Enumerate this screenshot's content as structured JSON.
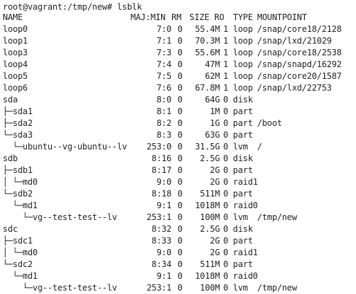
{
  "prompt": "root@vagrant:/tmp/new# lsblk",
  "headers": {
    "name": "NAME",
    "majmin": "MAJ:MIN",
    "rm": "RM",
    "size": "SIZE",
    "ro": "RO",
    "type": "TYPE",
    "mountpoint": "MOUNTPOINT"
  },
  "rows": [
    {
      "name": "loop0",
      "majmin": "7:0",
      "rm": "0",
      "size": "55.4M",
      "ro": "1",
      "type": "loop",
      "mountpoint": "/snap/core18/2128"
    },
    {
      "name": "loop1",
      "majmin": "7:1",
      "rm": "0",
      "size": "70.3M",
      "ro": "1",
      "type": "loop",
      "mountpoint": "/snap/lxd/21029"
    },
    {
      "name": "loop3",
      "majmin": "7:3",
      "rm": "0",
      "size": "55.6M",
      "ro": "1",
      "type": "loop",
      "mountpoint": "/snap/core18/2538"
    },
    {
      "name": "loop4",
      "majmin": "7:4",
      "rm": "0",
      "size": "47M",
      "ro": "1",
      "type": "loop",
      "mountpoint": "/snap/snapd/16292"
    },
    {
      "name": "loop5",
      "majmin": "7:5",
      "rm": "0",
      "size": "62M",
      "ro": "1",
      "type": "loop",
      "mountpoint": "/snap/core20/1587"
    },
    {
      "name": "loop6",
      "majmin": "7:6",
      "rm": "0",
      "size": "67.8M",
      "ro": "1",
      "type": "loop",
      "mountpoint": "/snap/lxd/22753"
    },
    {
      "name": "sda",
      "majmin": "8:0",
      "rm": "0",
      "size": "64G",
      "ro": "0",
      "type": "disk",
      "mountpoint": ""
    },
    {
      "name": "├─sda1",
      "majmin": "8:1",
      "rm": "0",
      "size": "1M",
      "ro": "0",
      "type": "part",
      "mountpoint": ""
    },
    {
      "name": "├─sda2",
      "majmin": "8:2",
      "rm": "0",
      "size": "1G",
      "ro": "0",
      "type": "part",
      "mountpoint": "/boot"
    },
    {
      "name": "└─sda3",
      "majmin": "8:3",
      "rm": "0",
      "size": "63G",
      "ro": "0",
      "type": "part",
      "mountpoint": ""
    },
    {
      "name": "  └─ubuntu--vg-ubuntu--lv",
      "majmin": "253:0",
      "rm": "0",
      "size": "31.5G",
      "ro": "0",
      "type": "lvm",
      "mountpoint": "/"
    },
    {
      "name": "sdb",
      "majmin": "8:16",
      "rm": "0",
      "size": "2.5G",
      "ro": "0",
      "type": "disk",
      "mountpoint": ""
    },
    {
      "name": "├─sdb1",
      "majmin": "8:17",
      "rm": "0",
      "size": "2G",
      "ro": "0",
      "type": "part",
      "mountpoint": ""
    },
    {
      "name": "│ └─md0",
      "majmin": "9:0",
      "rm": "0",
      "size": "2G",
      "ro": "0",
      "type": "raid1",
      "mountpoint": ""
    },
    {
      "name": "└─sdb2",
      "majmin": "8:18",
      "rm": "0",
      "size": "511M",
      "ro": "0",
      "type": "part",
      "mountpoint": ""
    },
    {
      "name": "  └─md1",
      "majmin": "9:1",
      "rm": "0",
      "size": "1018M",
      "ro": "0",
      "type": "raid0",
      "mountpoint": ""
    },
    {
      "name": "    └─vg--test-test--lv",
      "majmin": "253:1",
      "rm": "0",
      "size": "100M",
      "ro": "0",
      "type": "lvm",
      "mountpoint": "/tmp/new"
    },
    {
      "name": "sdc",
      "majmin": "8:32",
      "rm": "0",
      "size": "2.5G",
      "ro": "0",
      "type": "disk",
      "mountpoint": ""
    },
    {
      "name": "├─sdc1",
      "majmin": "8:33",
      "rm": "0",
      "size": "2G",
      "ro": "0",
      "type": "part",
      "mountpoint": ""
    },
    {
      "name": "│ └─md0",
      "majmin": "9:0",
      "rm": "0",
      "size": "2G",
      "ro": "0",
      "type": "raid1",
      "mountpoint": ""
    },
    {
      "name": "└─sdc2",
      "majmin": "8:34",
      "rm": "0",
      "size": "511M",
      "ro": "0",
      "type": "part",
      "mountpoint": ""
    },
    {
      "name": "  └─md1",
      "majmin": "9:1",
      "rm": "0",
      "size": "1018M",
      "ro": "0",
      "type": "raid0",
      "mountpoint": ""
    },
    {
      "name": "    └─vg--test-test--lv",
      "majmin": "253:1",
      "rm": "0",
      "size": "100M",
      "ro": "0",
      "type": "lvm",
      "mountpoint": "/tmp/new"
    }
  ]
}
